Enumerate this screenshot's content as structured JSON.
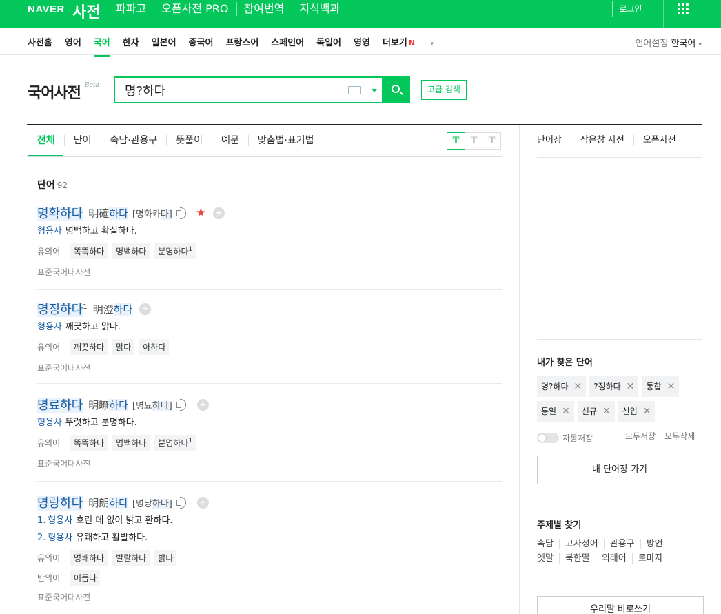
{
  "topbar": {
    "brand": "NAVER",
    "title": "사전",
    "nav": [
      "파파고",
      "오픈사전 PRO",
      "참여번역",
      "지식백과"
    ],
    "login": "로그인",
    "menu_icon": "grid-icon",
    "color": "#03c75a"
  },
  "langnav": {
    "items": [
      "사전홈",
      "영어",
      "국어",
      "한자",
      "일본어",
      "중국어",
      "프랑스어",
      "스페인어",
      "독일어",
      "영영",
      "더보기"
    ],
    "active": "국어",
    "more_badge": "N",
    "setting_label": "언어설정",
    "setting_value": "한국어"
  },
  "search": {
    "dict_name": "국어사전",
    "beta": "Beta",
    "query": "명?하다",
    "advanced": "고급 검색"
  },
  "tabs": {
    "items": [
      "전체",
      "단어",
      "속담·관용구",
      "뜻풀이",
      "예문",
      "맞춤법·표기법"
    ],
    "active": "전체",
    "text_size": [
      "T",
      "T",
      "T"
    ]
  },
  "results": {
    "section": "단어",
    "count": "92",
    "entries": [
      {
        "word_hl": "명확하다",
        "sup": "",
        "hanja_a": "明確",
        "hanja_b": "하다",
        "pron_a": "[명화카",
        "pron_b": "다]",
        "meanings": [
          {
            "num": "",
            "pos": "형용사",
            "text": "명백하고 확실하다."
          }
        ],
        "rel_label": "유의어",
        "rel": [
          "똑똑하다",
          "명백하다",
          "분명하다"
        ],
        "rel_sup": "1",
        "src": "표준국어대사전"
      },
      {
        "word_hl": "명징하다",
        "sup": "1",
        "hanja_a": "明澄",
        "hanja_b": "하다",
        "meanings": [
          {
            "num": "",
            "pos": "형용사",
            "text": "깨끗하고 맑다."
          }
        ],
        "rel_label": "유의어",
        "rel": [
          "깨끗하다",
          "맑다",
          "아하다"
        ],
        "src": "표준국어대사전"
      },
      {
        "word_hl": "명료하다",
        "sup": "",
        "hanja_a": "明瞭",
        "hanja_b": "하다",
        "pron_a": "[명뇨",
        "pron_b": "하다]",
        "meanings": [
          {
            "num": "",
            "pos": "형용사",
            "text": "뚜렷하고 분명하다."
          }
        ],
        "rel_label": "유의어",
        "rel": [
          "똑똑하다",
          "명백하다",
          "분명하다"
        ],
        "rel_sup": "1",
        "src": "표준국어대사전"
      },
      {
        "word_hl": "명랑하다",
        "sup": "",
        "hanja_a": "明朗",
        "hanja_b": "하다",
        "pron_a": "[명낭",
        "pron_b": "하다]",
        "meanings": [
          {
            "num": "1.",
            "pos": "형용사",
            "text": "흐린 데 없이 밝고 환하다."
          },
          {
            "num": "2.",
            "pos": "형용사",
            "text": "유쾌하고 활발하다."
          }
        ],
        "rel_label": "유의어",
        "rel": [
          "명쾌하다",
          "발랄하다",
          "밝다"
        ],
        "ant_label": "반의어",
        "ant": [
          "어둡다"
        ],
        "src": "표준국어대사전"
      }
    ]
  },
  "sidebar": {
    "tabs": [
      "단어장",
      "작은창 사전",
      "오픈사전"
    ],
    "recent_title": "내가 찾은 단어",
    "recent": [
      "명?하다",
      "?정하다",
      "통합",
      "통일",
      "신규",
      "신입"
    ],
    "autosave": "자동저장",
    "save_links": [
      "모두저장",
      "모두삭제"
    ],
    "my_button": "내 단어장 가기",
    "topic_title": "주제별 찾기",
    "topics": [
      "속담",
      "고사성어",
      "관용구",
      "방언",
      "옛말",
      "북한말",
      "외래어",
      "로마자"
    ],
    "bottom_button": "우리말 바로쓰기"
  }
}
